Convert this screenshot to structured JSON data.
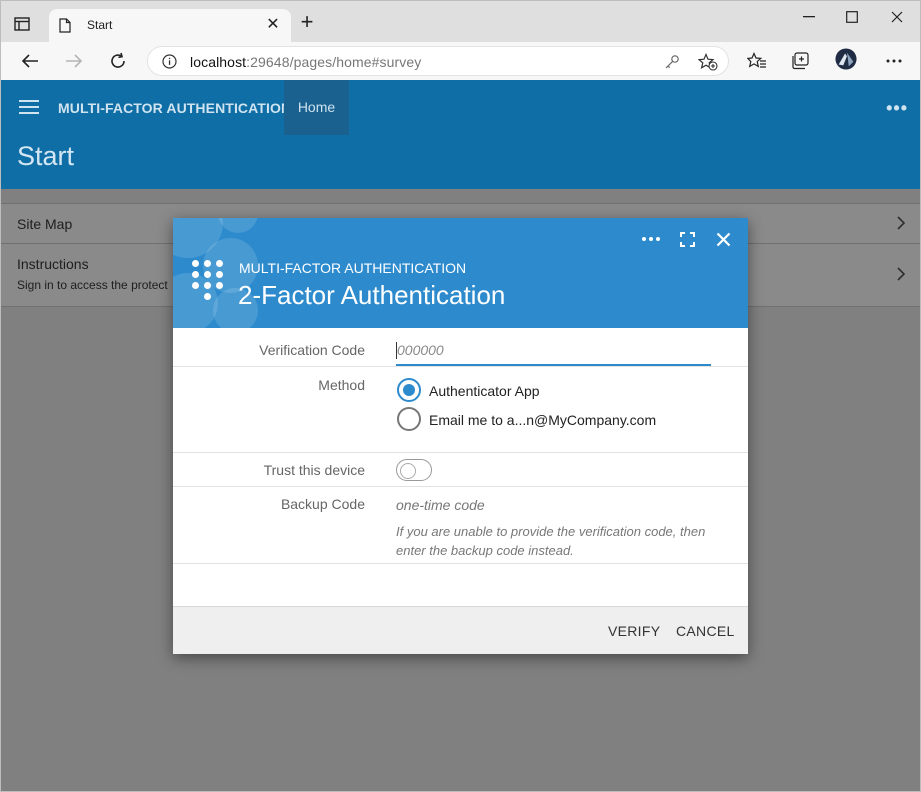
{
  "browser": {
    "tab_title": "Start",
    "url_host": "localhost",
    "url_rest": ":29648/pages/home#survey",
    "new_tab_symbol": "+",
    "tab_close_symbol": "✕"
  },
  "app": {
    "brand": "MULTI-FACTOR AUTHENTICATION",
    "nav_home": "Home",
    "page_title": "Start",
    "more_symbol": "•••"
  },
  "list": {
    "items": [
      {
        "label": "Site Map",
        "sub": ""
      },
      {
        "label": "Instructions",
        "sub": "Sign in to access the protect"
      }
    ]
  },
  "modal": {
    "subtitle": "MULTI-FACTOR AUTHENTICATION",
    "title": "2-Factor Authentication",
    "verification_label": "Verification Code",
    "verification_placeholder": "000000",
    "method_label": "Method",
    "methods": [
      {
        "label": "Authenticator App",
        "selected": true
      },
      {
        "label": "Email me to a...n@MyCompany.com",
        "selected": false
      }
    ],
    "trust_label": "Trust this device",
    "trust_on": false,
    "backup_label": "Backup Code",
    "backup_placeholder": "one-time code",
    "backup_hint": "If you are unable to provide the verification code, then enter the backup code instead.",
    "verify_button": "VERIFY",
    "cancel_button": "CANCEL"
  },
  "colors": {
    "app_bar": "#0f6ea5",
    "modal_header": "#2d8bcd",
    "overlay_gray": "#808080"
  }
}
